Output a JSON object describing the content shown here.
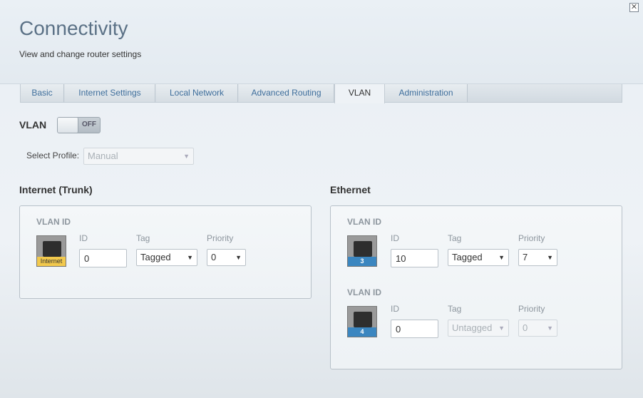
{
  "header": {
    "title": "Connectivity",
    "subtitle": "View and change router settings",
    "close_icon": "close-icon"
  },
  "tabs": [
    {
      "label": "Basic"
    },
    {
      "label": "Internet Settings"
    },
    {
      "label": "Local Network"
    },
    {
      "label": "Advanced Routing"
    },
    {
      "label": "VLAN",
      "active": true
    },
    {
      "label": "Administration"
    }
  ],
  "vlan": {
    "label": "VLAN",
    "toggle_text": "OFF",
    "profile_label": "Select Profile:",
    "profile_value": "Manual"
  },
  "internet_section": {
    "title": "Internet (Trunk)",
    "vlan_id_label": "VLAN ID",
    "port_label": "Internet",
    "id_label": "ID",
    "id_value": "0",
    "tag_label": "Tag",
    "tag_value": "Tagged",
    "priority_label": "Priority",
    "priority_value": "0"
  },
  "ethernet_section": {
    "title": "Ethernet",
    "ports": [
      {
        "vlan_id_label": "VLAN ID",
        "port_number": "3",
        "id_label": "ID",
        "id_value": "10",
        "tag_label": "Tag",
        "tag_value": "Tagged",
        "priority_label": "Priority",
        "priority_value": "7"
      },
      {
        "vlan_id_label": "VLAN ID",
        "port_number": "4",
        "id_label": "ID",
        "id_value": "0",
        "tag_label": "Tag",
        "tag_value": "Untagged",
        "priority_label": "Priority",
        "priority_value": "0"
      }
    ]
  },
  "colors": {
    "title": "#5b7186",
    "tab_link": "#3f6f9c",
    "port_badge_internet": "#f2c94c",
    "port_badge_ethernet": "#3b86c0"
  }
}
